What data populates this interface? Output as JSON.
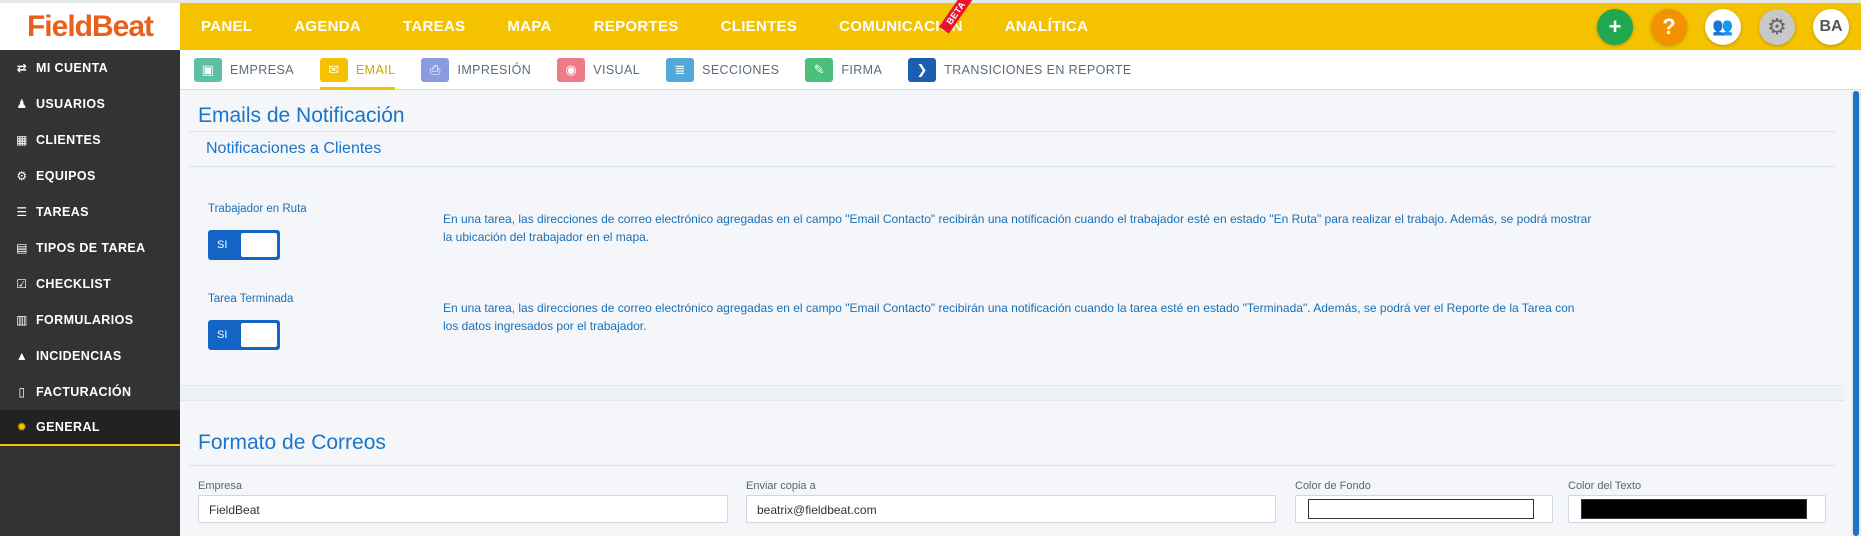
{
  "brand": {
    "part1": "Field",
    "part2": "Beat"
  },
  "nav": [
    "PANEL",
    "AGENDA",
    "TAREAS",
    "MAPA",
    "REPORTES",
    "CLIENTES",
    "COMUNICACIÓN",
    "ANALÍTICA"
  ],
  "beta_label": "BETA",
  "top_actions": {
    "add": "+",
    "help": "?",
    "user_initials": "BA"
  },
  "sidebar": [
    {
      "label": "MI CUENTA",
      "icon": "swap-icon",
      "glyph": "⇄"
    },
    {
      "label": "USUARIOS",
      "icon": "user-icon",
      "glyph": "👤"
    },
    {
      "label": "CLIENTES",
      "icon": "building-icon",
      "glyph": "▦"
    },
    {
      "label": "EQUIPOS",
      "icon": "equipment-icon",
      "glyph": "⚙"
    },
    {
      "label": "TAREAS",
      "icon": "tasks-icon",
      "glyph": "☰"
    },
    {
      "label": "TIPOS DE TAREA",
      "icon": "task-types-icon",
      "glyph": "▤"
    },
    {
      "label": "CHECKLIST",
      "icon": "checklist-icon",
      "glyph": "☑"
    },
    {
      "label": "FORMULARIOS",
      "icon": "forms-icon",
      "glyph": "▥"
    },
    {
      "label": "INCIDENCIAS",
      "icon": "warning-icon",
      "glyph": "▲"
    },
    {
      "label": "FACTURACIÓN",
      "icon": "invoice-icon",
      "glyph": "▯"
    },
    {
      "label": "GENERAL",
      "icon": "gear-icon",
      "glyph": "✹"
    }
  ],
  "tabs": [
    {
      "label": "EMPRESA",
      "icon": "briefcase-icon",
      "color": "#5cc0a3",
      "glyph": "▣"
    },
    {
      "label": "EMAIL",
      "icon": "envelope-icon",
      "color": "#f5c200",
      "glyph": "✉"
    },
    {
      "label": "IMPRESIÓN",
      "icon": "printer-icon",
      "color": "#8b9be0",
      "glyph": "⎙"
    },
    {
      "label": "VISUAL",
      "icon": "eye-icon",
      "color": "#ef7b8a",
      "glyph": "◉"
    },
    {
      "label": "SECCIONES",
      "icon": "sections-icon",
      "color": "#54a8d8",
      "glyph": "≣"
    },
    {
      "label": "FIRMA",
      "icon": "pen-icon",
      "color": "#4cc07a",
      "glyph": "✎"
    },
    {
      "label": "TRANSICIONES EN REPORTE",
      "icon": "chevron-right-icon",
      "color": "#1b5fb0",
      "glyph": "❯"
    }
  ],
  "section1": {
    "title": "Emails de Notificación",
    "subtitle": "Notificaciones a Clientes",
    "settings": [
      {
        "label": "Trabajador en Ruta",
        "toggle": "SI",
        "description": "En una tarea, las direcciones de correo electrónico agregadas en el campo \"Email Contacto\" recibirán una notificación cuando el trabajador esté en estado \"En Ruta\" para realizar el trabajo. Además, se podrá mostrar la ubicación del trabajador en el mapa."
      },
      {
        "label": "Tarea Terminada",
        "toggle": "SI",
        "description": "En una tarea, las direcciones de correo electrónico agregadas en el campo \"Email Contacto\" recibirán una notificación cuando la tarea esté en estado \"Terminada\". Además, se podrá ver el Reporte de la Tarea con los datos ingresados por el trabajador."
      }
    ]
  },
  "section2": {
    "title": "Formato de Correos",
    "fields": {
      "empresa_label": "Empresa",
      "empresa_value": "FieldBeat",
      "copia_label": "Enviar copia a",
      "copia_value": "beatrix@fieldbeat.com",
      "fondo_label": "Color de Fondo",
      "fondo_color": "#ffffff",
      "texto_label": "Color del Texto",
      "texto_color": "#000000"
    }
  }
}
